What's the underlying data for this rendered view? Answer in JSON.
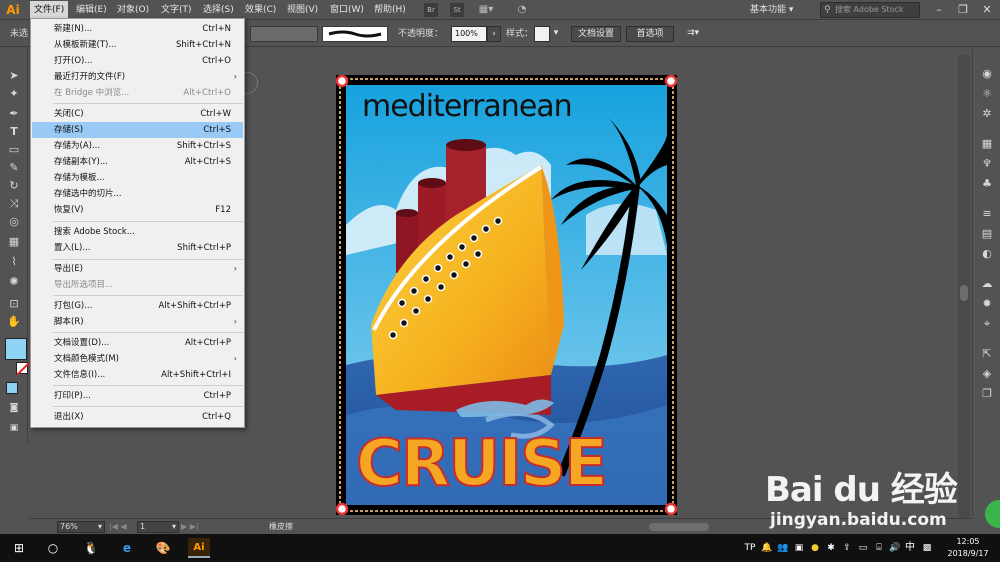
{
  "app": {
    "logo": "Ai",
    "menus": [
      "文件(F)",
      "编辑(E)",
      "对象(O)",
      "文字(T)",
      "选择(S)",
      "效果(C)",
      "视图(V)",
      "窗口(W)",
      "帮助(H)"
    ],
    "workspace": "基本功能",
    "stock_search_placeholder": "搜索 Adobe Stock",
    "bridge_icon": "Br",
    "stock_icon": "St"
  },
  "control_bar": {
    "selection_label": "未选",
    "opacity_label": "不透明度：",
    "opacity_value": "100%",
    "style_label": "样式：",
    "doc_setup_button": "文档设置",
    "preferences_button": "首选项"
  },
  "file_menu": {
    "items": [
      {
        "label": "新建(N)...",
        "shortcut": "Ctrl+N",
        "enabled": true,
        "submenu": false
      },
      {
        "label": "从模板新建(T)...",
        "shortcut": "Shift+Ctrl+N",
        "enabled": true,
        "submenu": false
      },
      {
        "label": "打开(O)...",
        "shortcut": "Ctrl+O",
        "enabled": true,
        "submenu": false
      },
      {
        "label": "最近打开的文件(F)",
        "shortcut": "",
        "enabled": true,
        "submenu": true
      },
      {
        "label": "在 Bridge 中浏览...",
        "shortcut": "Alt+Ctrl+O",
        "enabled": false,
        "submenu": false
      },
      {
        "label": "关闭(C)",
        "shortcut": "Ctrl+W",
        "enabled": true,
        "submenu": false
      },
      {
        "label": "存储(S)",
        "shortcut": "Ctrl+S",
        "enabled": true,
        "submenu": false,
        "highlighted": true
      },
      {
        "label": "存储为(A)...",
        "shortcut": "Shift+Ctrl+S",
        "enabled": true,
        "submenu": false
      },
      {
        "label": "存储副本(Y)...",
        "shortcut": "Alt+Ctrl+S",
        "enabled": true,
        "submenu": false
      },
      {
        "label": "存储为模板...",
        "shortcut": "",
        "enabled": true,
        "submenu": false
      },
      {
        "label": "存储选中的切片...",
        "shortcut": "",
        "enabled": true,
        "submenu": false
      },
      {
        "label": "恢复(V)",
        "shortcut": "F12",
        "enabled": true,
        "submenu": false
      },
      {
        "label": "搜索 Adobe Stock...",
        "shortcut": "",
        "enabled": true,
        "submenu": false
      },
      {
        "label": "置入(L)...",
        "shortcut": "Shift+Ctrl+P",
        "enabled": true,
        "submenu": false
      },
      {
        "label": "导出(E)",
        "shortcut": "",
        "enabled": true,
        "submenu": true
      },
      {
        "label": "导出所选项目...",
        "shortcut": "",
        "enabled": false,
        "submenu": false
      },
      {
        "label": "打包(G)...",
        "shortcut": "Alt+Shift+Ctrl+P",
        "enabled": true,
        "submenu": false
      },
      {
        "label": "脚本(R)",
        "shortcut": "",
        "enabled": true,
        "submenu": true
      },
      {
        "label": "文档设置(D)...",
        "shortcut": "Alt+Ctrl+P",
        "enabled": true,
        "submenu": false
      },
      {
        "label": "文档颜色模式(M)",
        "shortcut": "",
        "enabled": true,
        "submenu": true
      },
      {
        "label": "文件信息(I)...",
        "shortcut": "Alt+Shift+Ctrl+I",
        "enabled": true,
        "submenu": false
      },
      {
        "label": "打印(P)...",
        "shortcut": "Ctrl+P",
        "enabled": true,
        "submenu": false
      },
      {
        "label": "退出(X)",
        "shortcut": "Ctrl+Q",
        "enabled": true,
        "submenu": false
      }
    ]
  },
  "artwork": {
    "headline": "mediterranean",
    "title": "CRUISE"
  },
  "status_bar": {
    "zoom": "76%",
    "page": "1",
    "tool_name": "橡皮擦"
  },
  "taskbar": {
    "time": "12:05",
    "date": "2018/9/17",
    "ime": "中"
  },
  "watermark": {
    "brand": "Bai du 经验",
    "url": "jingyan.baidu.com"
  },
  "colors": {
    "ui_bg": "#535353",
    "menu_highlight": "#99c9f5",
    "ai_orange": "#ff9a00",
    "ship_yellow": "#f5b51f",
    "sky_blue": "#35aee3",
    "sea_blue": "#2a5fa8",
    "funnel_red": "#9c1b26"
  }
}
